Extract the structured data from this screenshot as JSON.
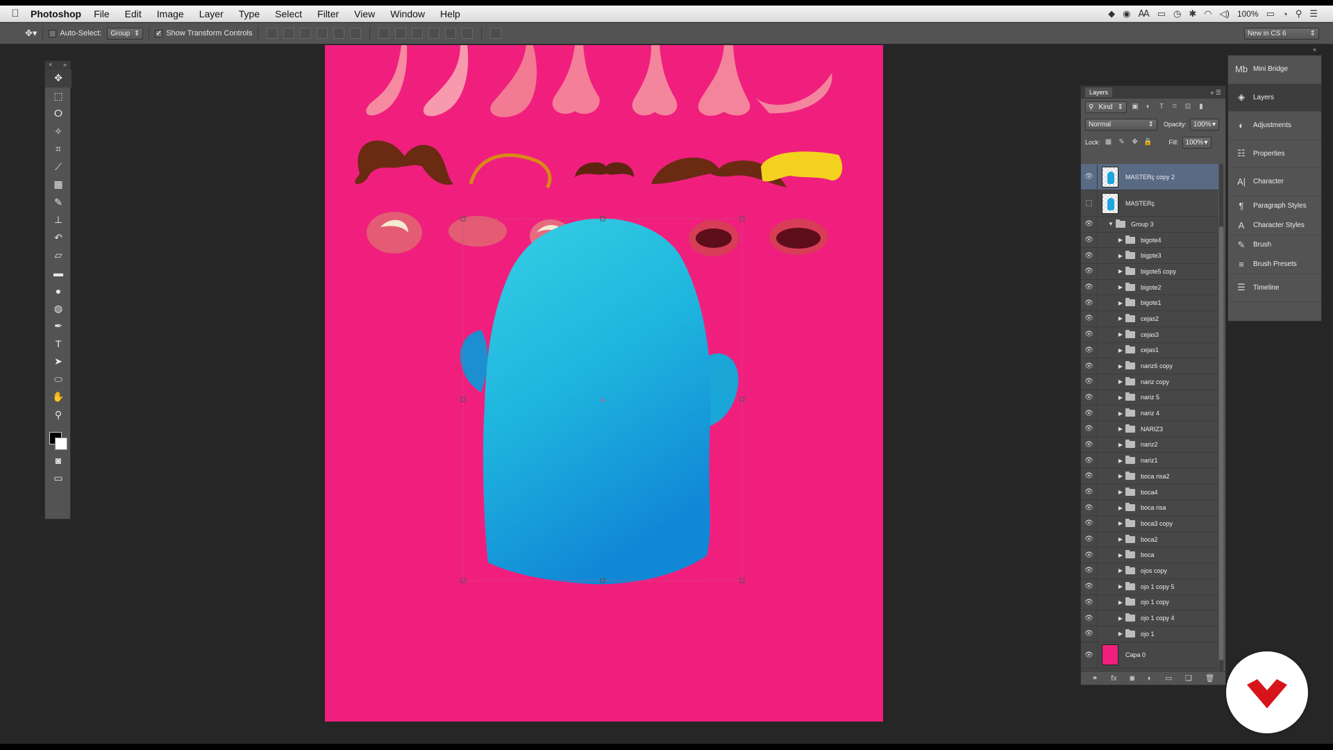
{
  "menubar": {
    "app_name": "Photoshop",
    "items": [
      "File",
      "Edit",
      "Image",
      "Layer",
      "Type",
      "Select",
      "Filter",
      "View",
      "Window",
      "Help"
    ],
    "status": {
      "battery": "100%",
      "icons": [
        "dropbox-icon",
        "record-icon",
        "adobe-icon",
        "screen-mirror-icon",
        "time-machine-icon",
        "bluetooth-icon",
        "wifi-icon",
        "volume-icon",
        "battery-icon",
        "clock-icon",
        "spotlight-icon",
        "notification-icon"
      ]
    }
  },
  "options_bar": {
    "auto_select_label": "Auto-Select:",
    "auto_select_checked": false,
    "auto_select_value": "Group",
    "show_transform_label": "Show Transform Controls",
    "show_transform_checked": true,
    "workspace": "New in CS 6"
  },
  "layers_panel": {
    "tab": "Layers",
    "filter_kind": "Kind",
    "blend_mode": "Normal",
    "opacity_label": "Opacity:",
    "opacity_value": "100%",
    "lock_label": "Lock:",
    "fill_label": "Fill:",
    "fill_value": "100%",
    "layers": [
      {
        "name": "MASTERç copy 2",
        "type": "pixel",
        "visible": true,
        "selected": true
      },
      {
        "name": "MASTERç",
        "type": "pixel",
        "visible": false,
        "selected": false
      },
      {
        "name": "Group 3",
        "type": "group-open",
        "visible": true
      },
      {
        "name": "bigote4",
        "type": "group",
        "visible": true
      },
      {
        "name": "bigpte3",
        "type": "group",
        "visible": true
      },
      {
        "name": "bigote5 copy",
        "type": "group",
        "visible": true
      },
      {
        "name": "bigote2",
        "type": "group",
        "visible": true
      },
      {
        "name": "bigote1",
        "type": "group",
        "visible": true
      },
      {
        "name": "cejas2",
        "type": "group",
        "visible": true
      },
      {
        "name": "cejas3",
        "type": "group",
        "visible": true
      },
      {
        "name": "cejas1",
        "type": "group",
        "visible": true
      },
      {
        "name": "nariz6 copy",
        "type": "group",
        "visible": true
      },
      {
        "name": "nariz copy",
        "type": "group",
        "visible": true
      },
      {
        "name": "nariz 5",
        "type": "group",
        "visible": true
      },
      {
        "name": "nariz 4",
        "type": "group",
        "visible": true
      },
      {
        "name": "NARIZ3",
        "type": "group",
        "visible": true
      },
      {
        "name": "nariz2",
        "type": "group",
        "visible": true
      },
      {
        "name": "nariz1",
        "type": "group",
        "visible": true
      },
      {
        "name": "boca risa2",
        "type": "group",
        "visible": true
      },
      {
        "name": "boca4",
        "type": "group",
        "visible": true
      },
      {
        "name": "boca risa",
        "type": "group",
        "visible": true
      },
      {
        "name": "boca3 copy",
        "type": "group",
        "visible": true
      },
      {
        "name": "boca2",
        "type": "group",
        "visible": true
      },
      {
        "name": "boca",
        "type": "group",
        "visible": true
      },
      {
        "name": "ojos copy",
        "type": "group",
        "visible": true
      },
      {
        "name": "ojo 1 copy 5",
        "type": "group",
        "visible": true
      },
      {
        "name": "ojo 1 copy",
        "type": "group",
        "visible": true
      },
      {
        "name": "ojo 1 copy 4",
        "type": "group",
        "visible": true
      },
      {
        "name": "ojo 1",
        "type": "group",
        "visible": true
      },
      {
        "name": "Capa 0",
        "type": "fill",
        "visible": true
      }
    ]
  },
  "dock": {
    "items": [
      {
        "label": "Mini Bridge",
        "icon": "mini-bridge-icon"
      },
      {
        "label": "Layers",
        "icon": "layers-icon"
      },
      {
        "label": "Adjustments",
        "icon": "adjustments-icon"
      },
      {
        "label": "Properties",
        "icon": "properties-icon"
      },
      {
        "label": "Character",
        "icon": "character-icon"
      },
      {
        "label": "Paragraph Styles",
        "icon": "paragraph-styles-icon"
      },
      {
        "label": "Character Styles",
        "icon": "character-styles-icon"
      },
      {
        "label": "Brush",
        "icon": "brush-icon"
      },
      {
        "label": "Brush Presets",
        "icon": "brush-presets-icon"
      },
      {
        "label": "Timeline",
        "icon": "timeline-icon"
      }
    ]
  },
  "canvas": {
    "background": "#f01f7e",
    "head_color": "#1ea5e0"
  },
  "colors": {
    "accent_selected": "#596a84",
    "logo_red": "#d7141a"
  }
}
